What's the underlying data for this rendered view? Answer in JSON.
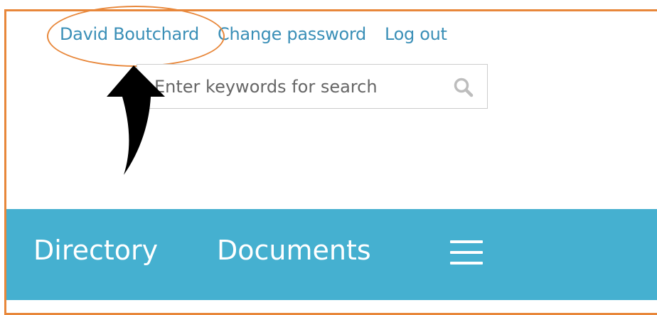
{
  "header": {
    "user_name": "David Boutchard",
    "change_password": "Change password",
    "log_out": "Log out"
  },
  "search": {
    "placeholder": "Enter keywords for search",
    "value": "",
    "icon": "search-icon"
  },
  "nav": {
    "items": [
      {
        "label": "Directory"
      },
      {
        "label": "Documents"
      }
    ],
    "menu_icon": "hamburger-menu-icon"
  },
  "colors": {
    "link": "#3a8fb7",
    "nav_background": "#45b0d0",
    "annotation": "#e8873a",
    "arrow": "#000000"
  }
}
